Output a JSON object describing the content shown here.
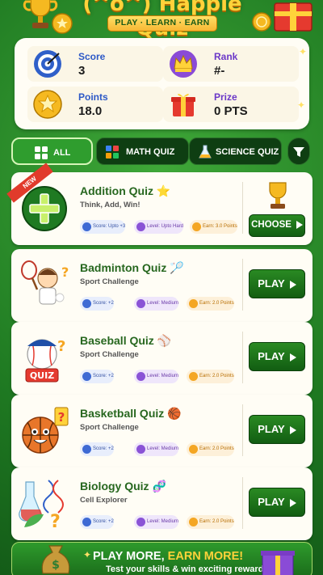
{
  "header": {
    "brand": "(^o^) Happie Quiz",
    "tagline": "PLAY · LEARN · EARN"
  },
  "stats": {
    "score": {
      "label": "Score",
      "value": "3"
    },
    "rank": {
      "label": "Rank",
      "value": "#-"
    },
    "points": {
      "label": "Points",
      "value": "18.0"
    },
    "prize": {
      "label": "Prize",
      "value": "0 PTS"
    }
  },
  "filters": {
    "all": "ALL",
    "math": "MATH QUIZ",
    "science": "SCIENCE QUIZ"
  },
  "quizzes": [
    {
      "title": "Addition Quiz ⭐",
      "subtitle": "Think, Add, Win!",
      "badge": "NEW",
      "score": "Score: Upto +3",
      "level": "Level: Upto Hard",
      "earn": "Earn: 3.0 Points",
      "action": "CHOOSE"
    },
    {
      "title": "Badminton Quiz 🏸",
      "subtitle": "Sport Challenge",
      "score": "Score: +2",
      "level": "Level: Medium",
      "earn": "Earn: 2.0 Points",
      "action": "PLAY"
    },
    {
      "title": "Baseball Quiz ⚾",
      "subtitle": "Sport Challenge",
      "thumb_text": "QUIZ",
      "score": "Score: +2",
      "level": "Level: Medium",
      "earn": "Earn: 2.0 Points",
      "action": "PLAY"
    },
    {
      "title": "Basketball Quiz 🏀",
      "subtitle": "Sport Challenge",
      "score": "Score: +2",
      "level": "Level: Medium",
      "earn": "Earn: 2.0 Points",
      "action": "PLAY"
    },
    {
      "title": "Biology Quiz 🧬",
      "subtitle": "Cell Explorer",
      "score": "Score: +2",
      "level": "Level: Medium",
      "earn": "Earn: 2.0 Points",
      "action": "PLAY"
    }
  ],
  "banner": {
    "line1_a": "PLAY MORE, ",
    "line1_b": "EARN MORE!",
    "line2": "Test your skills & win exciting rewards!"
  },
  "colors": {
    "background": "#1f7a22",
    "accent_gold": "#ffd23a",
    "button_green": "#125d12",
    "title_green": "#27671f"
  }
}
